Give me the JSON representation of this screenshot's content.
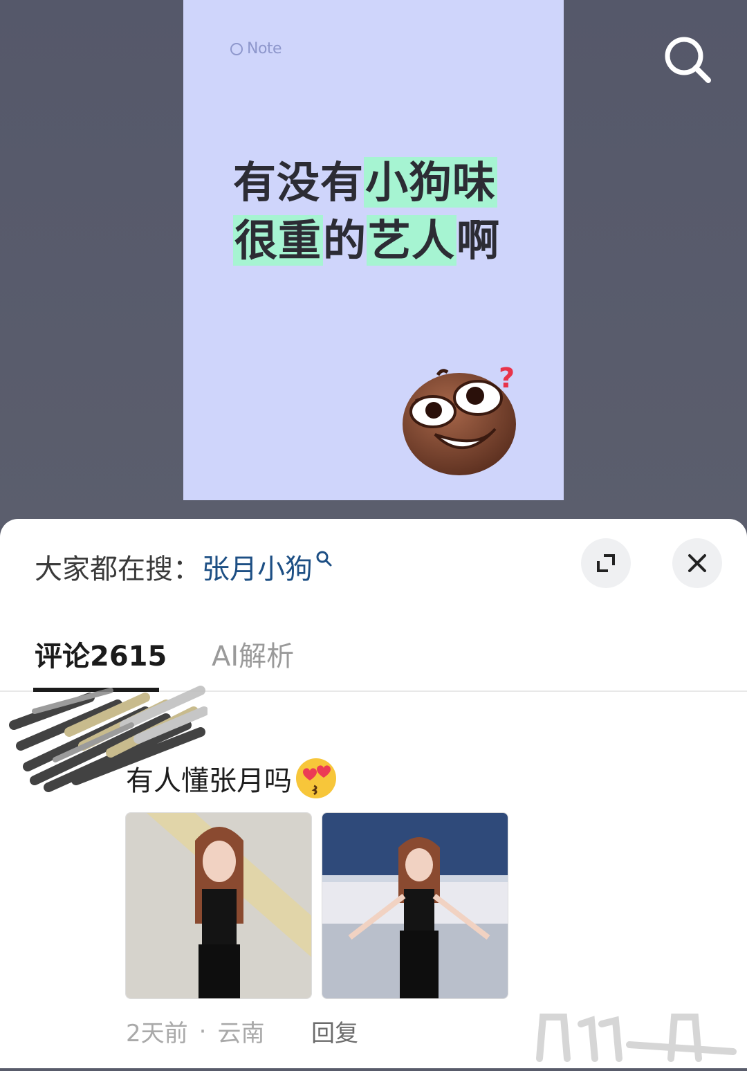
{
  "note": {
    "brand": "Note",
    "line1": [
      "有没有",
      "小狗味"
    ],
    "line2": [
      "很重",
      "的",
      "艺人",
      "啊"
    ]
  },
  "search": {
    "trend_prefix": "大家都在搜：",
    "trend_term": "张月小狗"
  },
  "tabs": {
    "comments_label": "评论",
    "comments_count": "2615",
    "ai_label": "AI解析"
  },
  "comment": {
    "text": "有人懂张月吗",
    "time": "2天前",
    "location": "云南",
    "reply_label": "回复"
  },
  "colors": {
    "backdrop": "#585b6a",
    "note_card": "#cfd5fb",
    "highlight": "#a6f4d2",
    "trend_link": "#1d4f84"
  },
  "icons": {
    "top_right": "search-icon",
    "expand": "expand-icon",
    "close": "close-icon",
    "trend_link": "search-small-icon"
  }
}
